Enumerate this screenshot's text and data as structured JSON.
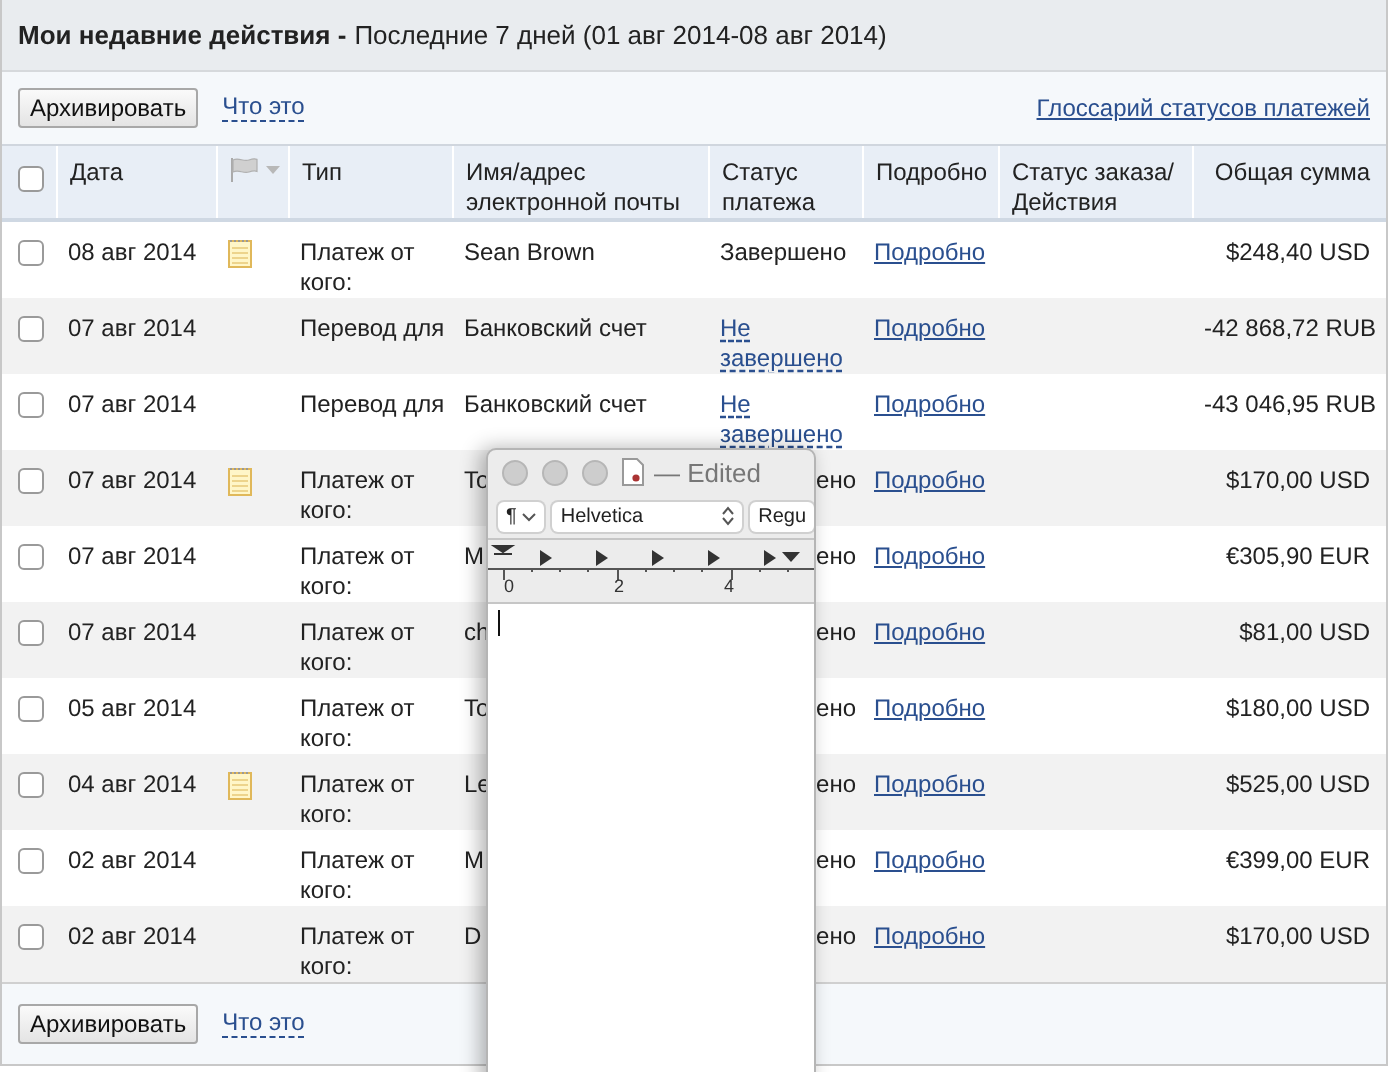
{
  "header": {
    "title": "Мои недавние действия -",
    "subtitle": "Последние 7 дней (01 авг 2014-08 авг 2014)"
  },
  "toolbar": {
    "archive_button": "Архивировать",
    "help_link": "Что это",
    "glossary_link": "Глоссарий статусов платежей"
  },
  "table": {
    "select_all": {
      "checked": false
    },
    "columns": [
      {
        "kind": "text",
        "label": "Дата"
      },
      {
        "kind": "flag"
      },
      {
        "kind": "text",
        "label": "Тип"
      },
      {
        "kind": "text",
        "label": "Имя/адрес электронной почты"
      },
      {
        "kind": "text",
        "label": "Статус платежа"
      },
      {
        "kind": "text",
        "label": "Подробно"
      },
      {
        "kind": "text",
        "label": "Статус заказа/ Действия"
      },
      {
        "kind": "amount",
        "label": "Общая сумма"
      }
    ],
    "rows": [
      {
        "kind": "plain",
        "checked": false,
        "date": "08 авг 2014",
        "note": true,
        "type": "Платеж от кого:",
        "name": "Sean Brown",
        "status": "Завершено",
        "details": "Подробно",
        "amount": "$248,40 USD"
      },
      {
        "kind": "link",
        "checked": false,
        "date": "07 авг 2014",
        "note": false,
        "type": "Перевод для",
        "name": "Банковский счет",
        "status": "Не завершено",
        "details": "Подробно",
        "amount": "-42 868,72 RUB"
      },
      {
        "kind": "link",
        "checked": false,
        "date": "07 авг 2014",
        "note": false,
        "type": "Перевод для",
        "name": "Банковский счет",
        "status": "Не завершено",
        "details": "Подробно",
        "amount": "-43 046,95 RUB"
      },
      {
        "kind": "covered",
        "checked": false,
        "date": "07 авг 2014",
        "note": true,
        "type": "Платеж от кого:",
        "name": "To",
        "status": "ено",
        "details": "Подробно",
        "amount": "$170,00 USD"
      },
      {
        "kind": "covered",
        "checked": false,
        "date": "07 авг 2014",
        "note": false,
        "type": "Платеж от кого:",
        "name": "M",
        "status": "ено",
        "details": "Подробно",
        "amount": "€305,90 EUR"
      },
      {
        "kind": "covered",
        "checked": false,
        "date": "07 авг 2014",
        "note": false,
        "type": "Платеж от кого:",
        "name": "ch",
        "status": "ено",
        "details": "Подробно",
        "amount": "$81,00 USD"
      },
      {
        "kind": "covered",
        "checked": false,
        "date": "05 авг 2014",
        "note": false,
        "type": "Платеж от кого:",
        "name": "To",
        "status": "ено",
        "details": "Подробно",
        "amount": "$180,00 USD"
      },
      {
        "kind": "covered",
        "checked": false,
        "date": "04 авг 2014",
        "note": true,
        "type": "Платеж от кого:",
        "name": "Le",
        "status": "ено",
        "details": "Подробно",
        "amount": "$525,00 USD"
      },
      {
        "kind": "covered",
        "checked": false,
        "date": "02 авг 2014",
        "note": false,
        "type": "Платеж от кого:",
        "name": "M",
        "status": "ено",
        "details": "Подробно",
        "amount": "€399,00 EUR"
      },
      {
        "kind": "covered",
        "checked": false,
        "date": "02 авг 2014",
        "note": false,
        "type": "Платеж от кого:",
        "name": "D",
        "status": "ено",
        "details": "Подробно",
        "amount": "$170,00 USD"
      }
    ]
  },
  "footer": {
    "archive_button": "Архивировать",
    "help_link": "Что это"
  },
  "editor_window": {
    "title": "— Edited",
    "paragraph_menu": "¶",
    "font_menu": "Helvetica",
    "style_menu": "Regu",
    "ruler_labels": [
      "0",
      "2",
      "4"
    ]
  }
}
